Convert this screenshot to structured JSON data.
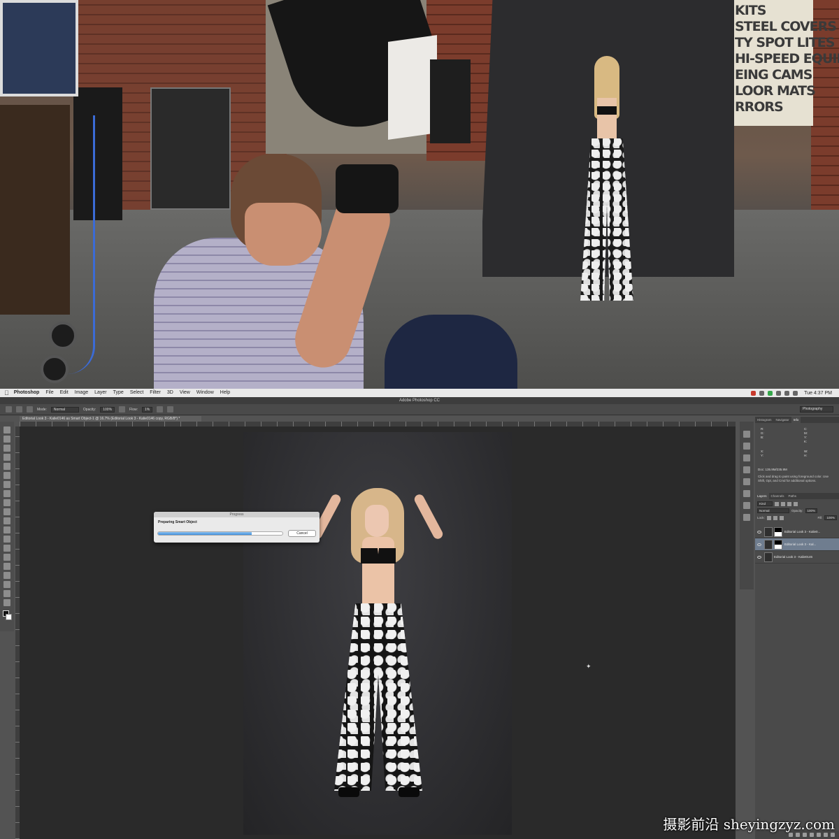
{
  "studio_sign": {
    "lines": [
      "KITS",
      "STEEL COVERS",
      "TY SPOT LITES",
      "HI-SPEED EQUIPMENT",
      "EING CAMS",
      "LOOR MATS",
      "RRORS"
    ]
  },
  "mac_menubar": {
    "items": [
      "Photoshop",
      "File",
      "Edit",
      "Image",
      "Layer",
      "Type",
      "Select",
      "Filter",
      "3D",
      "View",
      "Window",
      "Help"
    ],
    "clock": "Tue 4:37 PM"
  },
  "window": {
    "title": "Adobe Photoshop CC"
  },
  "options_bar": {
    "mode_label": "Mode:",
    "mode_value": "Normal",
    "opacity_label": "Opacity:",
    "opacity_value": "100%",
    "flow_label": "Flow:",
    "flow_value": "1%",
    "workspace": "Photography"
  },
  "document_tab": "Editorial Look 3 - Kalie0146 as Smart Object-1 @ 16.7% (Editorial Look 3 - Kalie0146 copy, RGB/8*) *",
  "progress_dialog": {
    "title": "Progress",
    "message": "Preparing Smart Object",
    "progress": 0.75,
    "cancel_label": "Cancel"
  },
  "info_panel": {
    "tabs": [
      "Histogram",
      "Navigator",
      "Info"
    ],
    "active_tab": "Info",
    "rgb": [
      "R:",
      "G:",
      "B:"
    ],
    "xy": [
      "X:",
      "Y:"
    ],
    "cmyk": [
      "C:",
      "M:",
      "Y:",
      "K:"
    ],
    "wh": [
      "W:",
      "H:"
    ],
    "doc_size": "Doc: 135.9M/235.9M",
    "hint": "Click and drag to paint using foreground color. Use Shift, Opt, and Cmd for additional options."
  },
  "layers_panel": {
    "tabs": [
      "Layers",
      "Channels",
      "Paths"
    ],
    "active_tab": "Layers",
    "filter_label": "Kind",
    "blend_mode": "Normal",
    "opacity_label": "Opacity:",
    "opacity_value": "100%",
    "lock_label": "Lock:",
    "fill_label": "Fill:",
    "fill_value": "100%",
    "layers": [
      {
        "name": "Editorial Look 3 - Kalie0...",
        "selected": false,
        "has_mask": true
      },
      {
        "name": "Editorial Look 3 - Kal...",
        "selected": true,
        "has_mask": true
      },
      {
        "name": "Editorial Look 3 - Kalie0146",
        "selected": false,
        "has_mask": false
      }
    ]
  },
  "watermark": "摄影前沿 sheyingzyz.com",
  "colors": {
    "progress_fill": "#3f8fdc",
    "selected_layer": "#6f7d8f",
    "ps_background": "#535353",
    "canvas_background": "#2a2a2a"
  }
}
